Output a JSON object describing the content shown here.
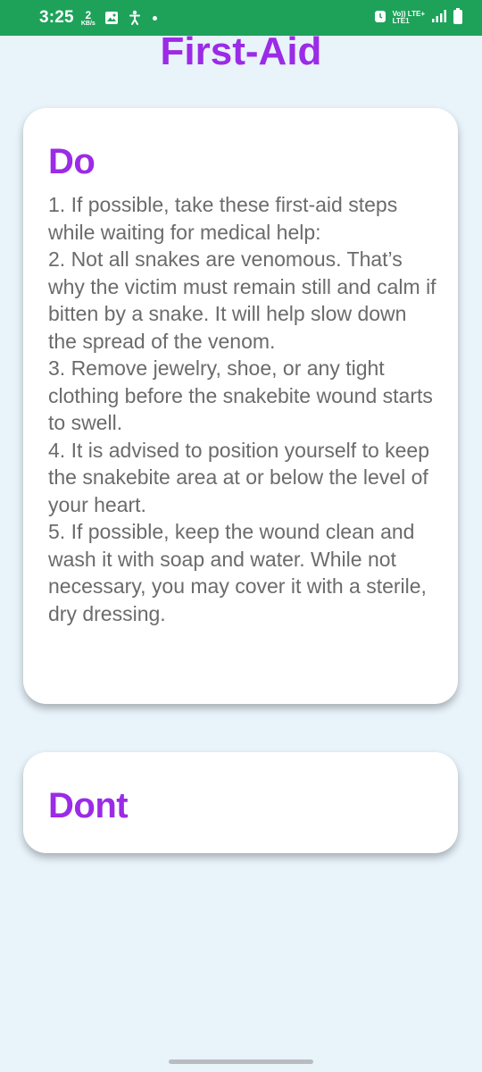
{
  "status_bar": {
    "time": "3:25",
    "speed_value": "2",
    "speed_unit": "KB/s",
    "network_top": "Vo)) LTE+",
    "network_bottom": "LTE1",
    "background_color": "#1ea25a"
  },
  "page": {
    "title": "First-Aid",
    "accent_color": "#9b2be6"
  },
  "do_card": {
    "heading": "Do",
    "body": "1. If possible, take these first-aid steps while waiting for medical help:\n 2. Not all snakes are venomous. That’s why the victim must remain still and calm if bitten by a snake. It will help slow down the spread of the venom.\n 3. Remove jewelry, shoe, or any tight clothing before the snakebite wound starts to swell.\n 4. It is advised to position yourself to keep the snakebite area at or below the level of your heart.\n 5. If possible, keep the wound clean and wash it with soap and water. While not necessary, you may cover it with a sterile, dry dressing."
  },
  "dont_card": {
    "heading": "Dont"
  }
}
